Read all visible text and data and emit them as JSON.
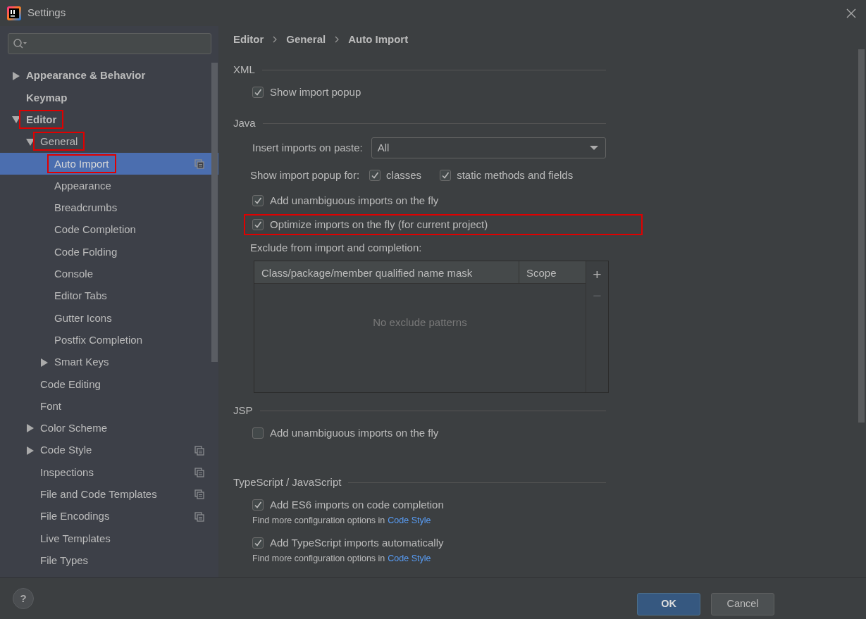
{
  "window": {
    "title": "Settings"
  },
  "sidebar": {
    "items": [
      {
        "label": "Appearance & Behavior",
        "expanded": false,
        "selected": false
      },
      {
        "label": "Keymap",
        "selected": false
      },
      {
        "label": "Editor",
        "expanded": true,
        "selected": false,
        "highlighted": true,
        "children": [
          {
            "label": "General",
            "expanded": true,
            "selected": false,
            "highlighted": true,
            "children": [
              {
                "label": "Auto Import",
                "selected": true,
                "highlighted": true,
                "project_level": true
              },
              {
                "label": "Appearance",
                "selected": false
              },
              {
                "label": "Breadcrumbs",
                "selected": false
              },
              {
                "label": "Code Completion",
                "selected": false
              },
              {
                "label": "Code Folding",
                "selected": false
              },
              {
                "label": "Console",
                "selected": false
              },
              {
                "label": "Editor Tabs",
                "selected": false
              },
              {
                "label": "Gutter Icons",
                "selected": false
              },
              {
                "label": "Postfix Completion",
                "selected": false
              },
              {
                "label": "Smart Keys",
                "expanded": false,
                "selected": false
              }
            ]
          },
          {
            "label": "Code Editing",
            "selected": false
          },
          {
            "label": "Font",
            "selected": false
          },
          {
            "label": "Color Scheme",
            "expanded": false,
            "selected": false
          },
          {
            "label": "Code Style",
            "expanded": false,
            "selected": false,
            "project_level": true
          },
          {
            "label": "Inspections",
            "selected": false,
            "project_level": true
          },
          {
            "label": "File and Code Templates",
            "selected": false,
            "project_level": true
          },
          {
            "label": "File Encodings",
            "selected": false,
            "project_level": true
          },
          {
            "label": "Live Templates",
            "selected": false
          },
          {
            "label": "File Types",
            "selected": false
          }
        ]
      }
    ]
  },
  "breadcrumb": [
    "Editor",
    "General",
    "Auto Import"
  ],
  "sections": [
    {
      "title": "XML",
      "rows": [
        {
          "kind": "checkbox",
          "label": "Show import popup",
          "checked": true
        }
      ]
    },
    {
      "title": "Java",
      "rows": [
        {
          "kind": "select",
          "label": "Insert imports on paste:",
          "value": "All"
        },
        {
          "kind": "checkgroup",
          "label": "Show import popup for:",
          "options": [
            {
              "label": "classes",
              "checked": true
            },
            {
              "label": "static methods and fields",
              "checked": true
            }
          ]
        },
        {
          "kind": "checkbox",
          "label": "Add unambiguous imports on the fly",
          "checked": true
        },
        {
          "kind": "checkbox",
          "label": "Optimize imports on the fly (for current project)",
          "checked": true,
          "highlighted": true
        },
        {
          "kind": "label",
          "text": "Exclude from import and completion:"
        },
        {
          "kind": "table",
          "columns": [
            "Class/package/member qualified name mask",
            "Scope"
          ],
          "empty_text": "No exclude patterns",
          "actions": [
            {
              "symbol": "+",
              "disabled": false
            },
            {
              "symbol": "−",
              "disabled": true
            }
          ]
        }
      ]
    },
    {
      "title": "JSP",
      "rows": [
        {
          "kind": "checkbox",
          "label": "Add unambiguous imports on the fly",
          "checked": false
        }
      ]
    },
    {
      "title": "TypeScript / JavaScript",
      "rows": [
        {
          "kind": "checkbox",
          "label": "Add ES6 imports on code completion",
          "checked": true
        },
        {
          "kind": "hint",
          "text": "Find more configuration options in",
          "link": "Code Style"
        },
        {
          "kind": "checkbox",
          "label": "Add TypeScript imports automatically",
          "checked": true
        },
        {
          "kind": "hint",
          "text": "Find more configuration options in",
          "link": "Code Style"
        }
      ]
    }
  ],
  "footer": {
    "help": "?",
    "buttons": [
      {
        "label": "OK",
        "default": true
      },
      {
        "label": "Cancel",
        "default": false
      }
    ]
  }
}
